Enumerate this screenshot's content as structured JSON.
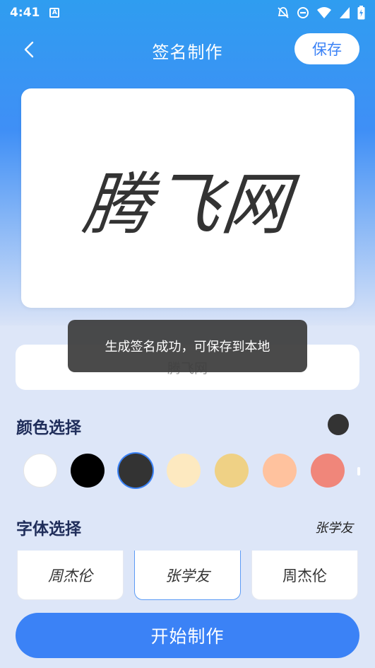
{
  "status_bar": {
    "time": "4:41",
    "notification_letter": "A"
  },
  "header": {
    "title": "签名制作",
    "save_label": "保存"
  },
  "preview": {
    "signature_text": "腾飞网"
  },
  "name_input": {
    "value": "腾飞网"
  },
  "toast": {
    "message": "生成签名成功，可保存到本地"
  },
  "color_section": {
    "title": "颜色选择",
    "selected_color": "#333333",
    "swatches": [
      "#ffffff",
      "#000000",
      "#333333",
      "#fde9c0",
      "#efd185",
      "#ffc29e",
      "#f0867a"
    ]
  },
  "font_section": {
    "title": "字体选择",
    "selected_preview": "张学友",
    "options": [
      {
        "label": "周杰伦"
      },
      {
        "label": "张学友"
      },
      {
        "label": "周杰伦"
      }
    ]
  },
  "start_button": {
    "label": "开始制作"
  },
  "accent_color": "#3b82f6"
}
